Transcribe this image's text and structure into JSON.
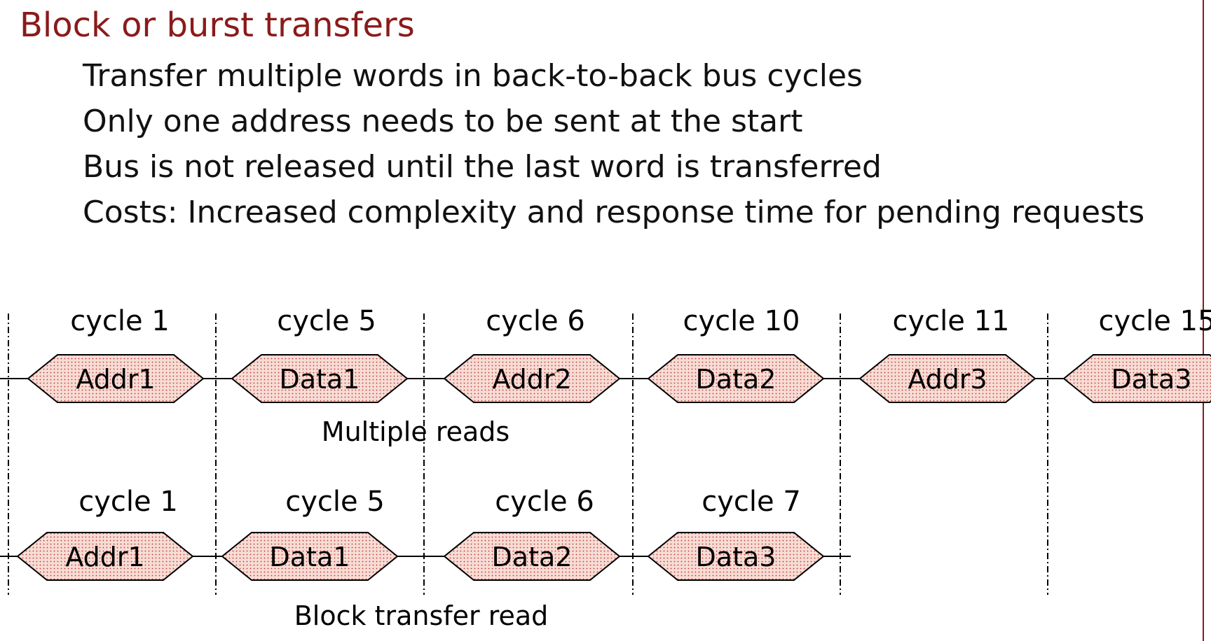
{
  "title": "Block or burst transfers",
  "bullets": [
    "Transfer multiple words in back-to-back bus cycles",
    "Only one address needs to be sent at the start",
    "Bus is not released until the last word is transferred",
    "Costs: Increased complexity and response time for pending requests"
  ],
  "diagram": {
    "multiple_reads": {
      "caption": "Multiple reads",
      "cycles": [
        "cycle 1",
        "cycle 5",
        "cycle 6",
        "cycle 10",
        "cycle 11",
        "cycle 15"
      ],
      "phases": [
        "Addr1",
        "Data1",
        "Addr2",
        "Data2",
        "Addr3",
        "Data3"
      ]
    },
    "block_transfer": {
      "caption": "Block transfer read",
      "cycles": [
        "cycle 1",
        "cycle 5",
        "cycle 6",
        "cycle 7"
      ],
      "phases": [
        "Addr1",
        "Data1",
        "Data2",
        "Data3"
      ]
    },
    "colors": {
      "fill": "#f7dcd6",
      "dot": "#c0392b",
      "title": "#8b1a1a"
    }
  }
}
